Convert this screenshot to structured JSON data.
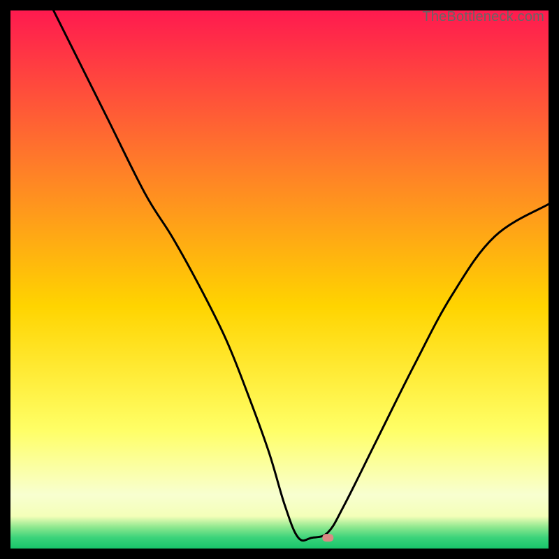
{
  "watermark": "TheBottleneck.com",
  "colors": {
    "black": "#000000",
    "curve": "#000000",
    "marker_fill": "#d98a84",
    "marker_stroke": "#c77069",
    "grad_top": "#ff1a4f",
    "grad_mid1": "#ff7a2a",
    "grad_mid2": "#ffd400",
    "grad_low1": "#ffff66",
    "grad_low2": "#f8ffd0",
    "grad_bottom_yellow": "#f4ffb8",
    "grad_green_top": "#8fe88f",
    "grad_green_mid": "#3ad37a",
    "grad_green_bot": "#18c56b"
  },
  "chart_data": {
    "type": "line",
    "title": "",
    "xlabel": "",
    "ylabel": "",
    "xlim": [
      0,
      100
    ],
    "ylim": [
      0,
      100
    ],
    "series": [
      {
        "name": "curve",
        "x": [
          8,
          12,
          18,
          25,
          30,
          35,
          40,
          44,
          48,
          51,
          53.5,
          56,
          59,
          62,
          68,
          75,
          82,
          90,
          100
        ],
        "y": [
          100,
          92,
          80,
          66,
          58,
          49,
          39,
          29,
          18,
          8,
          2,
          2,
          3,
          8,
          20,
          34,
          47,
          58,
          64
        ]
      }
    ],
    "flat_segment": {
      "x0": 53.5,
      "x1": 59,
      "y": 2
    },
    "marker": {
      "x": 59,
      "y": 2,
      "shape": "rounded-rect"
    }
  }
}
